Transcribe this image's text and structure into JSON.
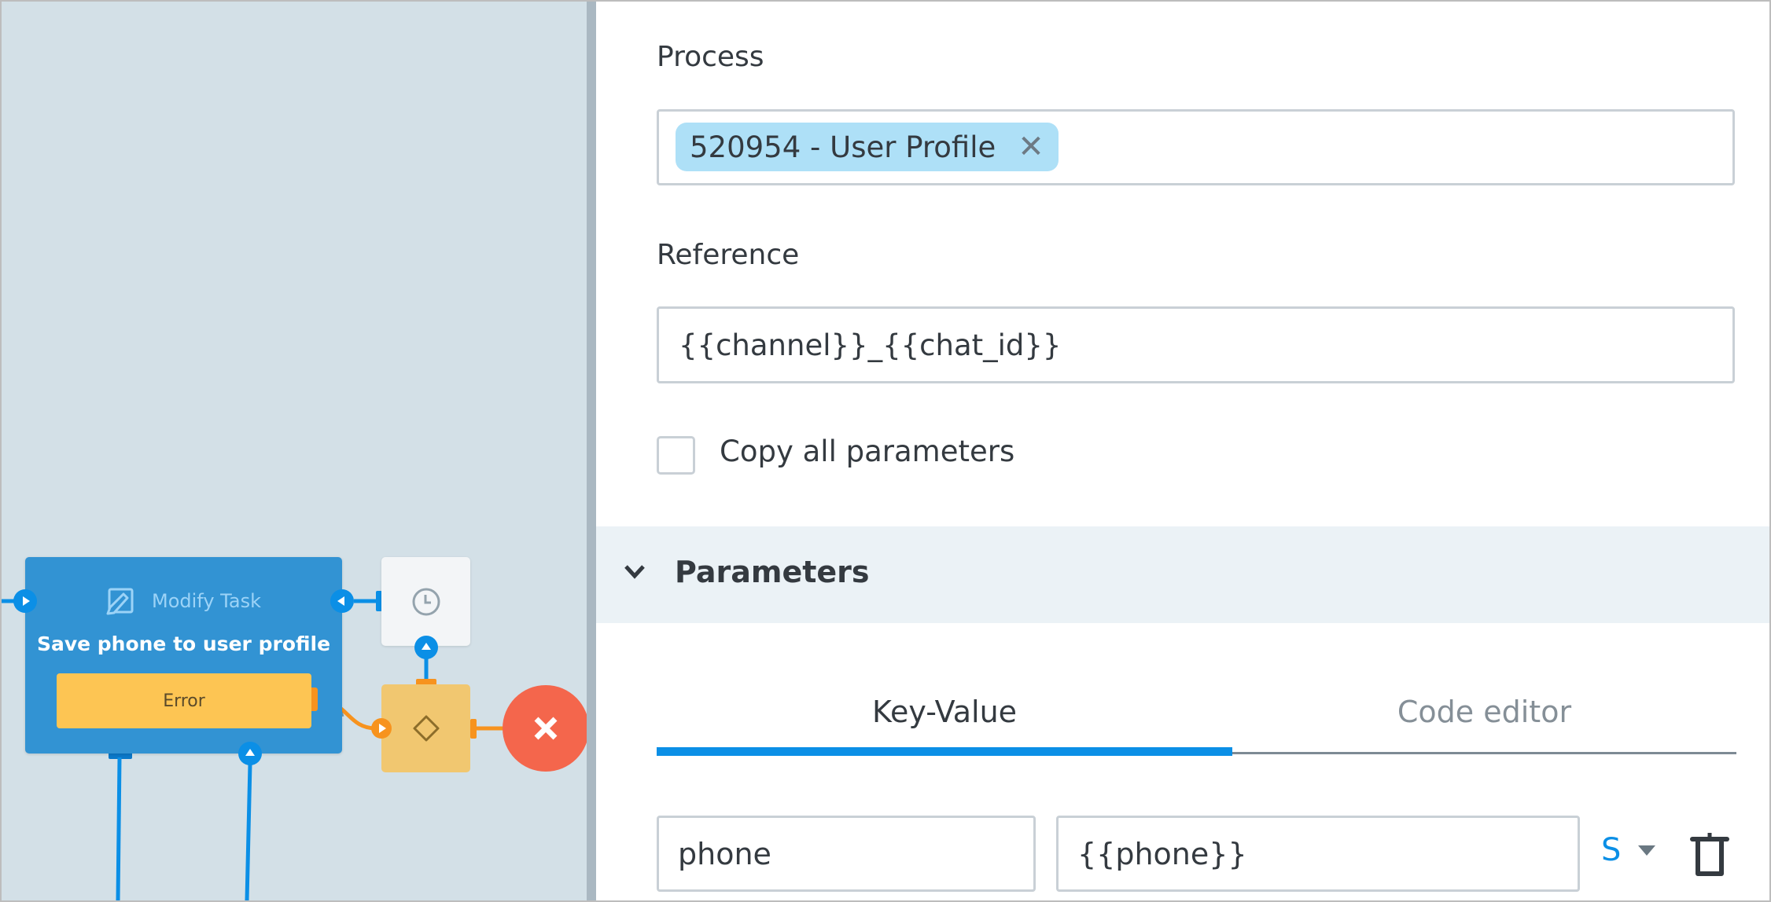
{
  "canvas": {
    "task_node": {
      "type_label": "Modify Task",
      "type_icon": "edit-icon",
      "title": "Save phone to user profile",
      "error_label": "Error"
    },
    "timer_node": {
      "icon": "clock-icon"
    },
    "gateway_node": {
      "icon": "diamond-icon"
    },
    "end_node": {
      "icon": "close-icon"
    },
    "colors": {
      "background": "#d3e0e7",
      "task": "#3293d3",
      "error": "#fdc553",
      "gateway": "#f1c770",
      "end": "#f4664c",
      "connector_blue": "#0b8fe6",
      "connector_orange": "#f7931e"
    }
  },
  "panel": {
    "process": {
      "label": "Process",
      "chip_text": "520954 - User Profile",
      "chip_remove_icon": "close-icon"
    },
    "reference": {
      "label": "Reference",
      "value": "{{channel}}_{{chat_id}}"
    },
    "copy_all": {
      "label": "Copy all parameters",
      "checked": false
    },
    "parameters_section": {
      "title": "Parameters",
      "expanded": true,
      "tabs": [
        {
          "label": "Key-Value",
          "active": true
        },
        {
          "label": "Code editor",
          "active": false
        }
      ],
      "rows": [
        {
          "key": "phone",
          "value": "{{phone}}",
          "type": "S"
        }
      ]
    },
    "accent_color": "#0b8fe6"
  }
}
